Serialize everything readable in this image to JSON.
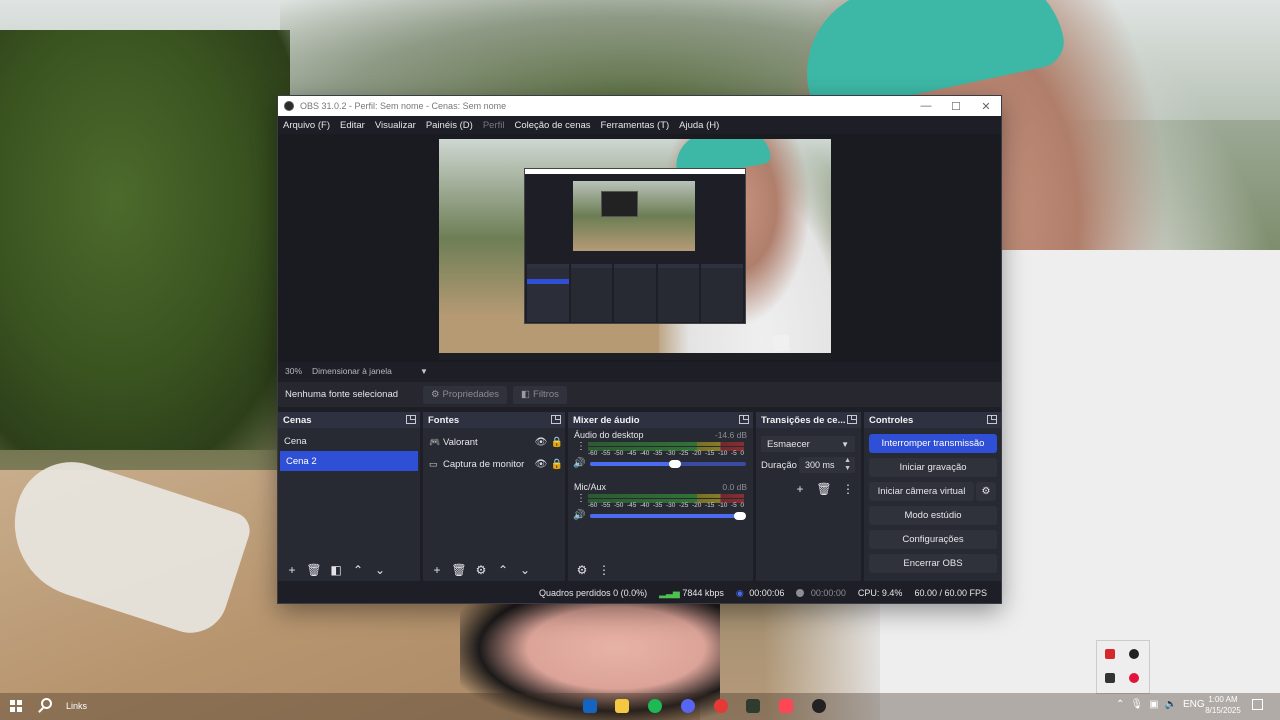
{
  "window": {
    "title": "OBS 31.0.2 - Perfil: Sem nome - Cenas: Sem nome",
    "controls": {
      "minimize": "—",
      "maximize": "☐",
      "close": "✕"
    }
  },
  "menu": [
    {
      "label": "Arquivo (F)",
      "enabled": true
    },
    {
      "label": "Editar",
      "enabled": true
    },
    {
      "label": "Visualizar",
      "enabled": true
    },
    {
      "label": "Painéis (D)",
      "enabled": true
    },
    {
      "label": "Perfil",
      "enabled": false
    },
    {
      "label": "Coleção de cenas",
      "enabled": true
    },
    {
      "label": "Ferramentas (T)",
      "enabled": true
    },
    {
      "label": "Ajuda (H)",
      "enabled": true
    }
  ],
  "zoom": {
    "value": "30%",
    "mode": "Dimensionar à janela"
  },
  "source_toolbar": {
    "no_source": "Nenhuma fonte selecionad",
    "properties": "Propriedades",
    "filters": "Filtros"
  },
  "scenes": {
    "title": "Cenas",
    "items": [
      {
        "name": "Cena",
        "selected": false
      },
      {
        "name": "Cena 2",
        "selected": true
      }
    ]
  },
  "sources": {
    "title": "Fontes",
    "items": [
      {
        "name": "Valorant",
        "icon": "gamepad-icon"
      },
      {
        "name": "Captura de monitor",
        "icon": "monitor-icon"
      }
    ]
  },
  "mixer": {
    "title": "Mixer de áudio",
    "channels": [
      {
        "name": "Áudio do desktop",
        "db": "-14.6 dB",
        "volume_fraction": 0.55,
        "level_fraction": 0.0
      },
      {
        "name": "Mic/Aux",
        "db": "0.0 dB",
        "volume_fraction": 1.0,
        "level_fraction": 0.1
      }
    ],
    "scale": [
      "-60",
      "-55",
      "-50",
      "-45",
      "-40",
      "-35",
      "-30",
      "-25",
      "-20",
      "-15",
      "-10",
      "-5",
      "0"
    ]
  },
  "transitions": {
    "title": "Transições de ce...",
    "selected": "Esmaecer",
    "duration_label": "Duração",
    "duration_value": "300 ms"
  },
  "controls": {
    "title": "Controles",
    "buttons": [
      "Interromper transmissão",
      "Iniciar gravação",
      "Iniciar câmera virtual",
      "Modo estúdio",
      "Configurações",
      "Encerrar OBS"
    ]
  },
  "status": {
    "dropped": "Quadros perdidos 0 (0.0%)",
    "bitrate": "7844 kbps",
    "live_time": "00:00:06",
    "rec_time": "00:00:00",
    "cpu": "CPU: 9.4%",
    "fps": "60.00 / 60.00 FPS"
  },
  "taskbar": {
    "links": "Links",
    "lang": "ENG",
    "time": "1:00 AM",
    "date": "8/15/2025",
    "apps": [
      {
        "name": "store-icon",
        "color": "#1565c0"
      },
      {
        "name": "folder-icon",
        "color": "#f5c842"
      },
      {
        "name": "spotify-icon",
        "color": "#1db954"
      },
      {
        "name": "discord-icon",
        "color": "#5865f2"
      },
      {
        "name": "chrome-icon",
        "color": "#e53935"
      },
      {
        "name": "terminal-icon",
        "color": "#2e3b2e"
      },
      {
        "name": "valorant-icon",
        "color": "#ff4655"
      },
      {
        "name": "obs-icon",
        "color": "#222222"
      }
    ]
  }
}
